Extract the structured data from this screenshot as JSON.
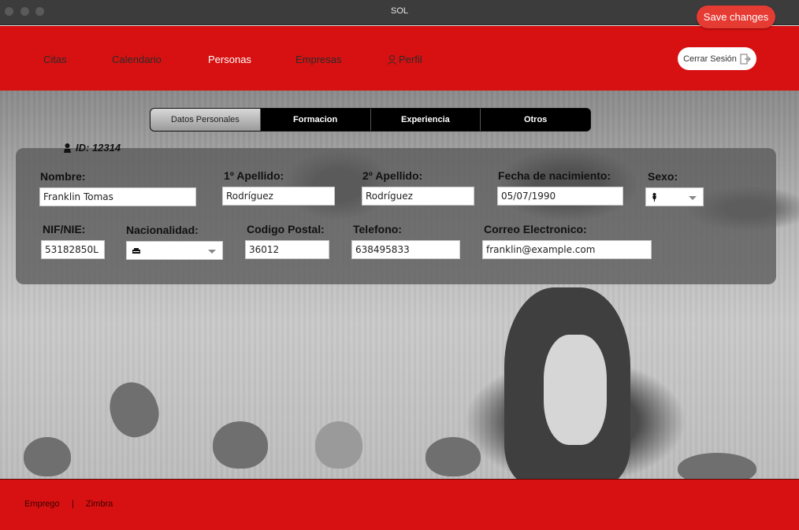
{
  "window": {
    "title": "SOL"
  },
  "toolbar": {
    "save_label": "Save changes"
  },
  "nav": {
    "items": [
      {
        "label": "Citas"
      },
      {
        "label": "Calendario"
      },
      {
        "label": "Personas"
      },
      {
        "label": "Empresas"
      },
      {
        "label": "Perfil"
      }
    ],
    "logout_label": "Cerrar Sesión"
  },
  "tabs": [
    "Datos Personales",
    "Formacion",
    "Experiencia",
    "Otros"
  ],
  "person": {
    "id_label": "ID: 12314"
  },
  "form": {
    "nombre": {
      "label": "Nombre:",
      "value": "Franklin Tomas"
    },
    "apellido1": {
      "label": "1º Apellido:",
      "value": "Rodríguez"
    },
    "apellido2": {
      "label": "2º Apellido:",
      "value": "Rodríguez"
    },
    "fecha": {
      "label": "Fecha de nacimiento:",
      "value": "05/07/1990"
    },
    "sexo": {
      "label": "Sexo:"
    },
    "nif": {
      "label": "NIF/NIE:",
      "value": "53182850L"
    },
    "nacionalidad": {
      "label": "Nacionalidad:"
    },
    "cp": {
      "label": "Codigo Postal:",
      "value": "36012"
    },
    "telefono": {
      "label": "Telefono:",
      "value": "638495833"
    },
    "email": {
      "label": "Correo Electronico:",
      "value": "franklin@example.com"
    }
  },
  "footer": {
    "links": [
      "Emprego",
      "|",
      "Zimbra"
    ]
  },
  "colors": {
    "brand_red": "#d71111",
    "save_button": "#e63b33"
  }
}
